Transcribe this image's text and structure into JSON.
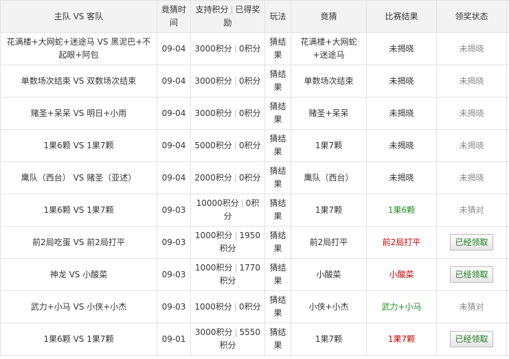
{
  "colors": {
    "result_green": "#1f8f1f",
    "result_red": "#cc0000",
    "status_grey": "#8a8a8a",
    "header_bg": "#f3f3f3",
    "border": "#e2e2e2"
  },
  "headers": {
    "match": "主队 VS 客队",
    "time": "竟猜时间",
    "points_support": "支持积分",
    "points_sep": "|",
    "points_reward": "已得奖励",
    "play": "玩法",
    "guess": "竟猜",
    "result": "比赛结果",
    "status": "领奖状态"
  },
  "rows": [
    {
      "match": "花满楼+大网蛇+迷途马 VS 黑泥巴+不起眼+阿包",
      "time": "09-04",
      "support": "3000积分",
      "reward": "0积分",
      "play": "猜结果",
      "guess": "花满楼+大网蛇+迷途马",
      "result": "未揭晓",
      "result_color": "#333333",
      "status": "未揭晓",
      "claim_button": false
    },
    {
      "match": "单数场次结束 VS 双数场次结束",
      "time": "09-04",
      "support": "3000积分",
      "reward": "0积分",
      "play": "猜结果",
      "guess": "单数场次结束",
      "result": "未揭晓",
      "result_color": "#333333",
      "status": "未揭晓",
      "claim_button": false
    },
    {
      "match": "赌圣+呆呆 VS 明日+小雨",
      "time": "09-04",
      "support": "3000积分",
      "reward": "0积分",
      "play": "猜结果",
      "guess": "赌圣+呆呆",
      "result": "未揭晓",
      "result_color": "#333333",
      "status": "未揭晓",
      "claim_button": false
    },
    {
      "match": "1果6颗 VS 1果7颗",
      "time": "09-04",
      "support": "5000积分",
      "reward": "0积分",
      "play": "猜结果",
      "guess": "1果7颗",
      "result": "未揭晓",
      "result_color": "#333333",
      "status": "未揭晓",
      "claim_button": false
    },
    {
      "match": "鹰队（西台） VS 赌圣（亚述）",
      "time": "09-04",
      "support": "2000积分",
      "reward": "0积分",
      "play": "猜结果",
      "guess": "鹰队（西台）",
      "result": "未揭晓",
      "result_color": "#333333",
      "status": "未揭晓",
      "claim_button": false
    },
    {
      "match": "1果6颗 VS 1果7颗",
      "time": "09-03",
      "support": "10000积分",
      "reward": "0积分",
      "play": "猜结果",
      "guess": "1果7颗",
      "result": "1果6颗",
      "result_color": "#1f8f1f",
      "status": "未猜对",
      "claim_button": false
    },
    {
      "match": "前2局吃蛋 VS 前2局打平",
      "time": "09-03",
      "support": "1000积分",
      "reward": "1950积分",
      "play": "猜结果",
      "guess": "前2局打平",
      "result": "前2局打平",
      "result_color": "#cc0000",
      "status": "已经领取",
      "claim_button": true
    },
    {
      "match": "神龙 VS 小酸菜",
      "time": "09-03",
      "support": "1000积分",
      "reward": "1770积分",
      "play": "猜结果",
      "guess": "小酸菜",
      "result": "小酸菜",
      "result_color": "#cc0000",
      "status": "已经领取",
      "claim_button": true
    },
    {
      "match": "武力+小马 VS 小侠+小杰",
      "time": "09-03",
      "support": "1000积分",
      "reward": "0积分",
      "play": "猜结果",
      "guess": "小侠+小杰",
      "result": "武力+小马",
      "result_color": "#1f8f1f",
      "status": "未猜对",
      "claim_button": false
    },
    {
      "match": "1果6颗 VS 1果7颗",
      "time": "09-01",
      "support": "3000积分",
      "reward": "5550积分",
      "play": "猜结果",
      "guess": "1果7颗",
      "result": "1果7颗",
      "result_color": "#cc0000",
      "status": "已经领取",
      "claim_button": true
    }
  ]
}
